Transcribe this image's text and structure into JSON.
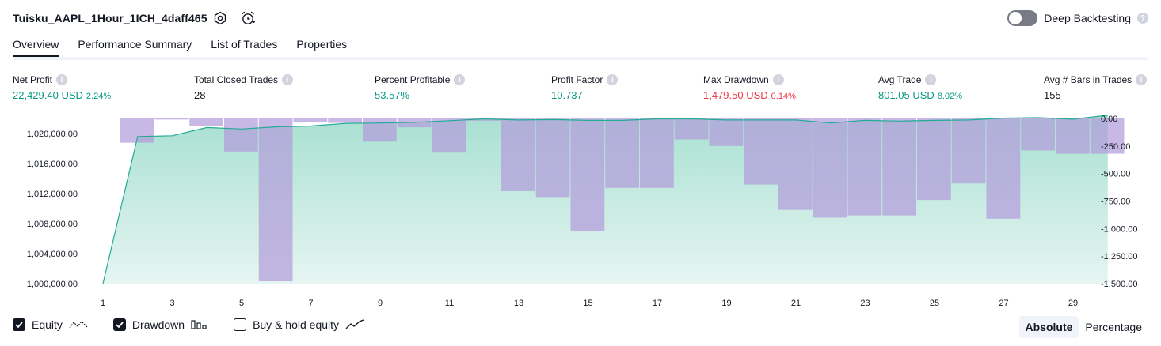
{
  "header": {
    "strategy_name": "Tuisku_AAPL_1Hour_1ICH_4daff465",
    "settings_icon": "gear-icon",
    "alert_icon": "alarm-clock-plus-icon",
    "deep_backtesting_label": "Deep Backtesting",
    "deep_backtesting_enabled": false
  },
  "tabs": [
    {
      "label": "Overview",
      "active": true
    },
    {
      "label": "Performance Summary",
      "active": false
    },
    {
      "label": "List of Trades",
      "active": false
    },
    {
      "label": "Properties",
      "active": false
    }
  ],
  "metrics": [
    {
      "label": "Net Profit",
      "value": "22,429.40 USD",
      "pct": "2.24%",
      "color": "#089981"
    },
    {
      "label": "Total Closed Trades",
      "value": "28",
      "pct": "",
      "color": "#131722"
    },
    {
      "label": "Percent Profitable",
      "value": "53.57%",
      "pct": "",
      "color": "#089981"
    },
    {
      "label": "Profit Factor",
      "value": "10.737",
      "pct": "",
      "color": "#089981"
    },
    {
      "label": "Max Drawdown",
      "value": "1,479.50 USD",
      "pct": "0.14%",
      "color": "#f23645"
    },
    {
      "label": "Avg Trade",
      "value": "801.05 USD",
      "pct": "8.02%",
      "color": "#089981"
    },
    {
      "label": "Avg # Bars in Trades",
      "value": "155",
      "pct": "",
      "color": "#131722"
    }
  ],
  "chart_data": {
    "type": "line",
    "x": [
      1,
      2,
      3,
      4,
      5,
      6,
      7,
      8,
      9,
      10,
      11,
      12,
      13,
      14,
      15,
      16,
      17,
      18,
      19,
      20,
      21,
      22,
      23,
      24,
      25,
      26,
      27,
      28,
      29
    ],
    "x_tick_labels": [
      "1",
      "3",
      "5",
      "7",
      "9",
      "11",
      "13",
      "15",
      "17",
      "19",
      "21",
      "23",
      "25",
      "27",
      "29"
    ],
    "series": [
      {
        "name": "Equity",
        "type": "area",
        "axis": "left",
        "color": "#22ab94",
        "values": [
          1000000,
          1019600,
          1019700,
          1020800,
          1020600,
          1020900,
          1021000,
          1021350,
          1021400,
          1021500,
          1021700,
          1021950,
          1021800,
          1021850,
          1021750,
          1021750,
          1021950,
          1021950,
          1021800,
          1021800,
          1021800,
          1021400,
          1021750,
          1021650,
          1021750,
          1021800,
          1022050,
          1022100,
          1021900,
          1022429
        ]
      },
      {
        "name": "Drawdown",
        "type": "bar",
        "axis": "right",
        "color": "#b39ddb",
        "values": [
          0,
          -220,
          -10,
          -70,
          -300,
          -1479,
          -30,
          -40,
          -210,
          -80,
          -310,
          -20,
          -660,
          -720,
          -1020,
          -630,
          -630,
          -190,
          -250,
          -600,
          -830,
          -900,
          -880,
          -880,
          -740,
          -590,
          -910,
          -290,
          -320,
          -320
        ]
      }
    ],
    "y_left_ticks": [
      "1,000,000.00",
      "1,004,000.00",
      "1,008,000.00",
      "1,012,000.00",
      "1,016,000.00",
      "1,020,000.00"
    ],
    "y_left_range": [
      1000000,
      1022000
    ],
    "y_right_ticks": [
      "0.00",
      "-250.00",
      "-500.00",
      "-750.00",
      "-1,000.00",
      "-1,250.00",
      "-1,500.00"
    ],
    "y_right_range": [
      -1500,
      0
    ]
  },
  "legend": [
    {
      "label": "Equity",
      "checked": true,
      "icon": "equity-line-icon"
    },
    {
      "label": "Drawdown",
      "checked": true,
      "icon": "drawdown-bars-icon"
    },
    {
      "label": "Buy & hold equity",
      "checked": false,
      "icon": "buy-hold-line-icon"
    }
  ],
  "view_mode": {
    "options": [
      "Absolute",
      "Percentage"
    ],
    "selected": "Absolute"
  }
}
